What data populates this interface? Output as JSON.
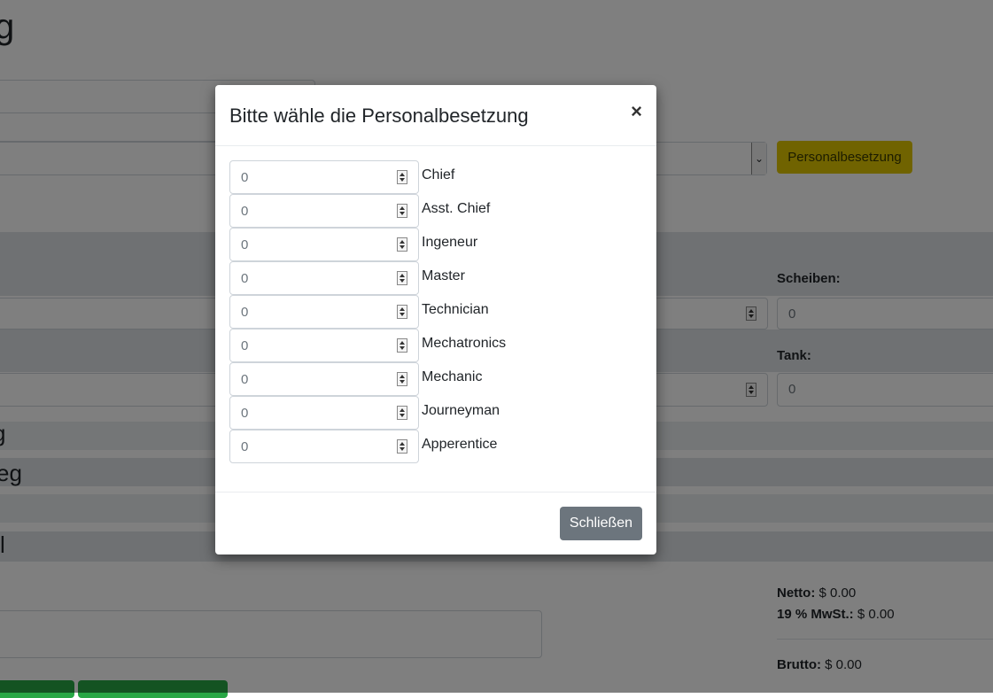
{
  "page": {
    "title_fragment": "g",
    "personal_button": "Personalbesetzung",
    "scheiben_label": "Scheiben:",
    "scheiben_value": "0",
    "tank_label": "Tank:",
    "tank_value": "0",
    "section_a": "g",
    "section_b": "eg",
    "section_c": "l",
    "netto_label": "Netto:",
    "netto_value": "$ 0.00",
    "mwst_label": "19 % MwSt.:",
    "mwst_value": "$ 0.00",
    "brutto_label": "Brutto:",
    "brutto_value": "$ 0.00"
  },
  "modal": {
    "title": "Bitte wähle die Personalbesetzung",
    "close_symbol": "×",
    "rows": [
      {
        "label": "Chief",
        "value": "0"
      },
      {
        "label": "Asst. Chief",
        "value": "0"
      },
      {
        "label": "Ingeneur",
        "value": "0"
      },
      {
        "label": "Master",
        "value": "0"
      },
      {
        "label": "Technician",
        "value": "0"
      },
      {
        "label": "Mechatronics",
        "value": "0"
      },
      {
        "label": "Mechanic",
        "value": "0"
      },
      {
        "label": "Journeyman",
        "value": "0"
      },
      {
        "label": "Apperentice",
        "value": "0"
      }
    ],
    "close_button": "Schließen"
  }
}
